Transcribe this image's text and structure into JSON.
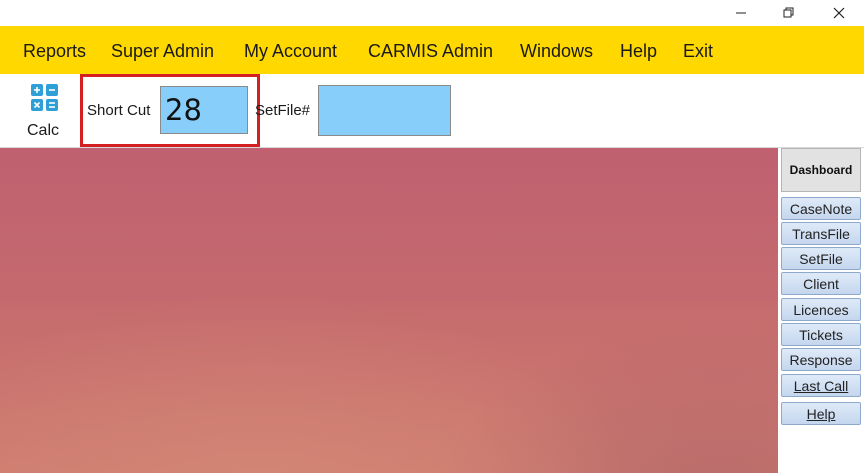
{
  "window": {
    "minimize_glyph": "—",
    "restore_icon": "restore-icon",
    "close_icon": "close-icon"
  },
  "menu": {
    "items": [
      "Reports",
      "Super Admin",
      "My Account",
      "CARMIS Admin",
      "Windows",
      "Help",
      "Exit"
    ]
  },
  "toolbar": {
    "calc_label": "Calc",
    "calc_icon": "calculator-icon",
    "shortcut_label": "Short Cut",
    "shortcut_value": "28",
    "setfile_label": "SetFile#",
    "setfile_value": ""
  },
  "sidepanel": {
    "dashboard_label": "Dashboard",
    "buttons": [
      "CaseNote",
      "TransFile",
      "SetFile",
      "Client",
      "Licences",
      "Tickets",
      "Response",
      "Last Call",
      "Help"
    ]
  },
  "colors": {
    "menu_bar": "#ffd800",
    "input_fill": "#87cefa",
    "highlight_frame": "#d42020",
    "nav_button": "#c4d6ee"
  }
}
